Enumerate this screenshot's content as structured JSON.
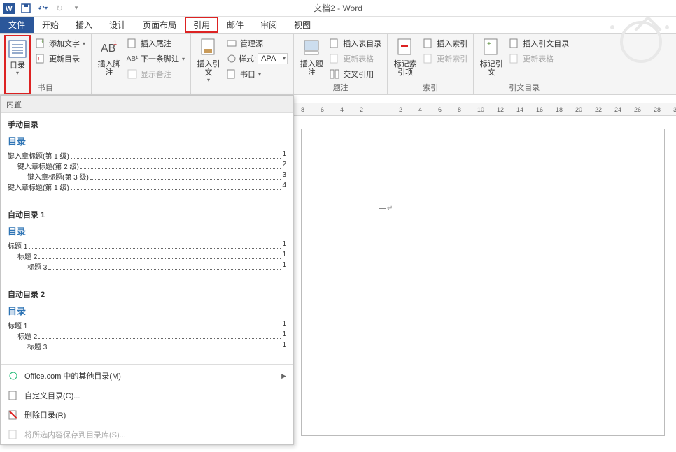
{
  "title": "文档2 - Word",
  "tabs": [
    "文件",
    "开始",
    "插入",
    "设计",
    "页面布局",
    "引用",
    "邮件",
    "审阅",
    "视图"
  ],
  "active_tab_index": 5,
  "ribbon": {
    "toc": {
      "big": "目录",
      "add_text": "添加文字",
      "update": "更新目录",
      "group_tail": "书目"
    },
    "footnotes": {
      "big": "插入脚注",
      "endnote": "插入尾注",
      "next": "下一条脚注",
      "show": "显示备注"
    },
    "citations": {
      "big": "插入引文",
      "manage": "管理源",
      "style_label": "样式:",
      "style_value": "APA",
      "biblio": "书目"
    },
    "captions": {
      "big": "插入题注",
      "group": "题注",
      "insert_tof": "插入表目录",
      "update_tbl": "更新表格",
      "crossref": "交叉引用"
    },
    "index": {
      "big": "标记索引项",
      "group": "索引",
      "insert": "插入索引",
      "update": "更新索引"
    },
    "toa": {
      "big": "标记引文",
      "group": "引文目录",
      "insert": "插入引文目录",
      "update": "更新表格"
    }
  },
  "dropdown": {
    "builtin": "内置",
    "sections": [
      {
        "title": "手动目录",
        "heading": "目录",
        "lines": [
          {
            "t": "键入章标题(第 1 级)",
            "p": "1",
            "l": 1
          },
          {
            "t": "键入章标题(第 2 级)",
            "p": "2",
            "l": 2
          },
          {
            "t": "键入章标题(第 3 级)",
            "p": "3",
            "l": 3
          },
          {
            "t": "键入章标题(第 1 级)",
            "p": "4",
            "l": 1
          }
        ]
      },
      {
        "title": "自动目录 1",
        "heading": "目录",
        "lines": [
          {
            "t": "标题 1",
            "p": "1",
            "l": 1
          },
          {
            "t": "标题 2",
            "p": "1",
            "l": 2
          },
          {
            "t": "标题 3",
            "p": "1",
            "l": 3
          }
        ]
      },
      {
        "title": "自动目录 2",
        "heading": "目录",
        "lines": [
          {
            "t": "标题 1",
            "p": "1",
            "l": 1
          },
          {
            "t": "标题 2",
            "p": "1",
            "l": 2
          },
          {
            "t": "标题 3",
            "p": "1",
            "l": 3
          }
        ]
      }
    ],
    "more": "Office.com 中的其他目录(M)",
    "custom": "自定义目录(C)...",
    "remove": "删除目录(R)",
    "save": "将所选内容保存到目录库(S)..."
  },
  "ruler_ticks": [
    8,
    6,
    4,
    2,
    "",
    2,
    4,
    6,
    8,
    10,
    12,
    14,
    16,
    18,
    20,
    22,
    24,
    26,
    28,
    3
  ]
}
